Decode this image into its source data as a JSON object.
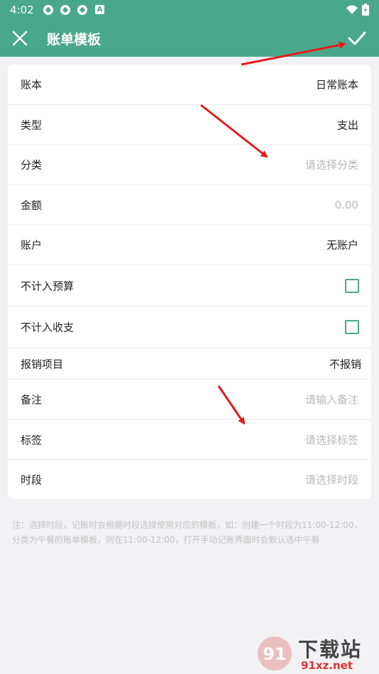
{
  "status": {
    "time": "4:02",
    "notif_letter": "A"
  },
  "appbar": {
    "title": "账单模板"
  },
  "rows": [
    {
      "label": "账本",
      "value": "日常账本"
    },
    {
      "label": "类型",
      "value": "支出"
    },
    {
      "label": "分类",
      "placeholder": "请选择分类"
    },
    {
      "label": "金额",
      "placeholder": "0.00"
    },
    {
      "label": "账户",
      "value": "无账户"
    },
    {
      "label": "不计入预算",
      "checked": false
    },
    {
      "label": "不计入收支",
      "checked": false
    },
    {
      "label": "报销项目",
      "value": "不报销"
    },
    {
      "label": "备注",
      "placeholder": "请输入备注"
    },
    {
      "label": "标签",
      "placeholder": "请选择标签"
    },
    {
      "label": "时段",
      "placeholder": "请选择时段"
    }
  ],
  "note": "注：选择时段，记账时会根据时段选择使用对应的模板，如：创建一个时段为11:00-12:00，分类为午餐的账单模板，则在11:00-12:00，打开手动记账界面时会默认选中午餐",
  "watermark": {
    "text_main": "下载站",
    "text_url": "91xz.net",
    "logo_text": "91"
  },
  "colors": {
    "primary": "#4aa88a",
    "annotation_arrow": "#e31b1b"
  },
  "icons": {
    "close": "close-icon",
    "confirm": "check-icon",
    "wifi": "wifi-icon",
    "battery": "battery-icon"
  }
}
